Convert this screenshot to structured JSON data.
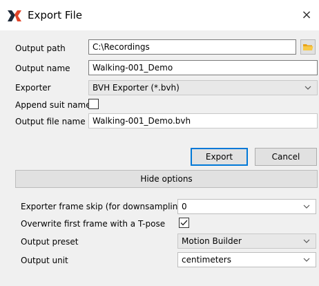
{
  "window": {
    "title": "Export File",
    "close_glyph": "×",
    "logo_icon": "xsens-x-logo",
    "accent_color": "#0078d7"
  },
  "form": {
    "output_path": {
      "label": "Output path",
      "value": "C:\\Recordings",
      "button_icon": "folder-icon"
    },
    "output_name": {
      "label": "Output name",
      "value": "Walking-001_Demo"
    },
    "exporter": {
      "label": "Exporter",
      "value": "BVH Exporter (*.bvh)"
    },
    "append_suit_name": {
      "label": "Append suit name",
      "checked": false
    },
    "output_file_name": {
      "label": "Output file name",
      "value": "Walking-001_Demo.bvh"
    }
  },
  "buttons": {
    "export": "Export",
    "cancel": "Cancel",
    "hide_options": "Hide options"
  },
  "options": {
    "frame_skip": {
      "label": "Exporter frame skip (for downsampling)",
      "value": "0"
    },
    "overwrite_tpose": {
      "label": "Overwrite first frame with a T-pose",
      "checked": true
    },
    "output_preset": {
      "label": "Output preset",
      "value": "Motion Builder"
    },
    "output_unit": {
      "label": "Output unit",
      "value": "centimeters"
    }
  }
}
